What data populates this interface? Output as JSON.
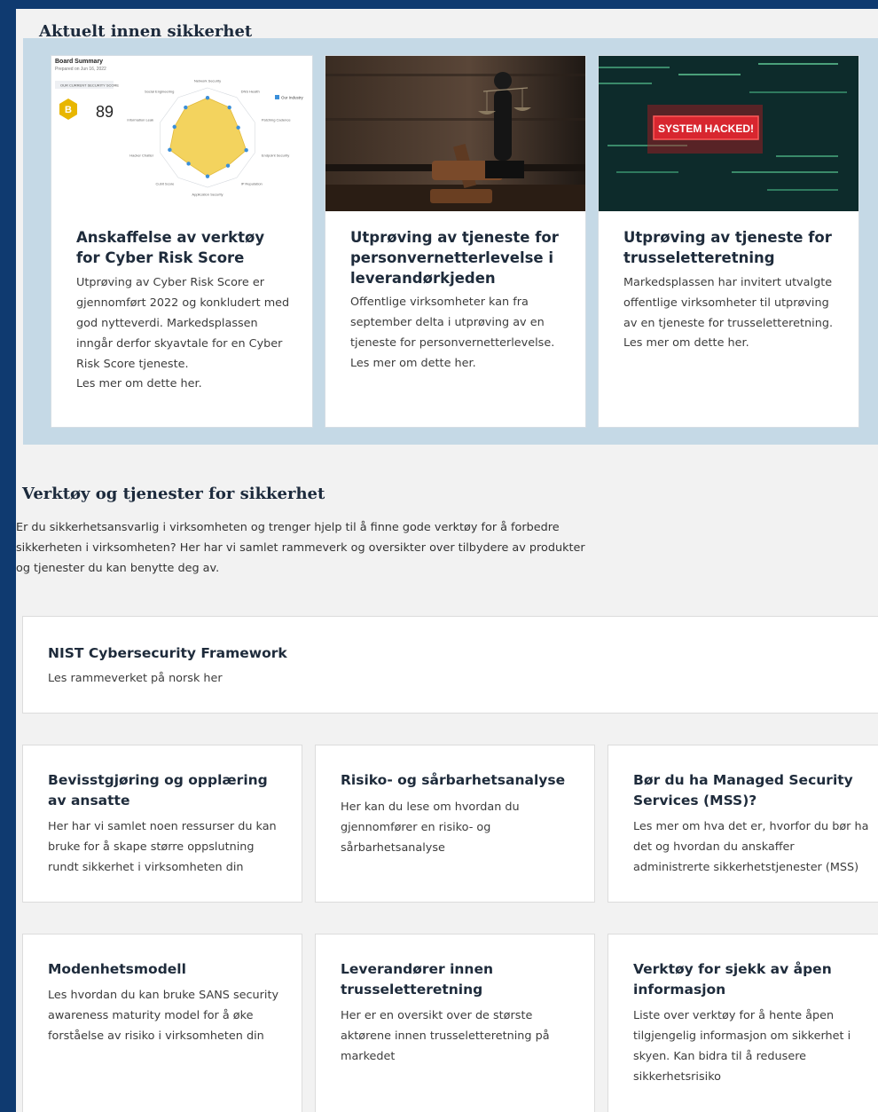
{
  "news": {
    "title": "Aktuelt innen sikkerhet",
    "cards": [
      {
        "title": "Anskaffelse av verktøy for Cyber Risk Score",
        "body": "Utprøving av Cyber Risk Score er gjennomført 2022 og konkludert med god nytteverdi. Markedsplassen inngår derfor skyavtale for en Cyber Risk Score tjeneste.",
        "more": "Les mer om dette her.",
        "image": {
          "heading": "Board Summary",
          "subheading": "Prepared on Jun 16, 2022",
          "score_label": "OUR CURRENT SECURITY SCORE",
          "grade": "B",
          "score": "89",
          "legend": "Our Industry",
          "axis_labels": [
            "Network Security",
            "DNS Health",
            "Patching Cadence",
            "Endpoint Security",
            "IP Reputation",
            "Application Security",
            "Cubit Score",
            "Hacker Chatter",
            "Information Leak",
            "Social Engineering"
          ],
          "radar_values": [
            0.8,
            0.75,
            0.65,
            0.82,
            0.7,
            0.78,
            0.65,
            0.8,
            0.7,
            0.75
          ],
          "radar_color": "#f3d35e",
          "accent": "#e8b600"
        }
      },
      {
        "title": "Utprøving av tjeneste for personvernetterlevelse i leverandørkjeden",
        "body": "Offentlige virksomheter kan fra september delta i utprøving av en tjeneste for personvernetterlevelse.",
        "more": "Les mer om dette her.",
        "image": {
          "icon": "justice-statue-gavel-icon"
        }
      },
      {
        "title": "Utprøving av tjeneste for trusseletteretning",
        "body": "Markedsplassen har invitert utvalgte offentlige virksomheter til utprøving av en tjeneste for trusseletteretning.",
        "more": "Les mer om dette her.",
        "image": {
          "banner": "SYSTEM HACKED!",
          "banner_color": "#d8262f"
        }
      }
    ]
  },
  "tools": {
    "title": "Verktøy og tjenester for sikkerhet",
    "intro": "Er du sikkerhetsansvarlig i virksomheten og trenger hjelp til å finne gode verktøy for å forbedre sikkerheten i virksomheten? Her har vi samlet rammeverk og oversikter over tilbydere av produkter og tjenester du kan benytte deg av.",
    "framework": {
      "title": "NIST Cybersecurity Framework",
      "desc": "Les rammeverket på norsk her"
    },
    "tiles": [
      {
        "title": "Bevisstgjøring og opplæring av ansatte",
        "desc": "Her har vi samlet noen ressurser du kan bruke for å skape større oppslutning rundt sikkerhet i virksomheten din"
      },
      {
        "title": "Risiko- og sårbarhetsanalyse",
        "desc": "Her kan du lese om hvordan du gjennomfører en risiko- og sårbarhetsanalyse"
      },
      {
        "title": "Bør du ha Managed Security Services (MSS)?",
        "desc": "Les mer om hva det er, hvorfor du bør ha det og hvordan du anskaffer administrerte sikkerhetstjenester (MSS)"
      },
      {
        "title": "Modenhetsmodell",
        "desc": "Les hvordan du kan bruke SANS security awareness maturity model for å øke forståelse av risiko i virksomheten din"
      },
      {
        "title": "Leverandører innen trusseletteretning",
        "desc": "Her er en oversikt over de største aktørene innen trusseletteretning på markedet"
      },
      {
        "title": "Verktøy for sjekk av åpen informasjon",
        "desc": "Liste over verktøy for å hente åpen tilgjengelig informasjon om sikkerhet i skyen. Kan bidra til å redusere sikkerhetsrisiko"
      }
    ]
  },
  "colors": {
    "frame": "#0f3a70",
    "band": "#c5d9e6",
    "page": "#f2f2f2"
  }
}
